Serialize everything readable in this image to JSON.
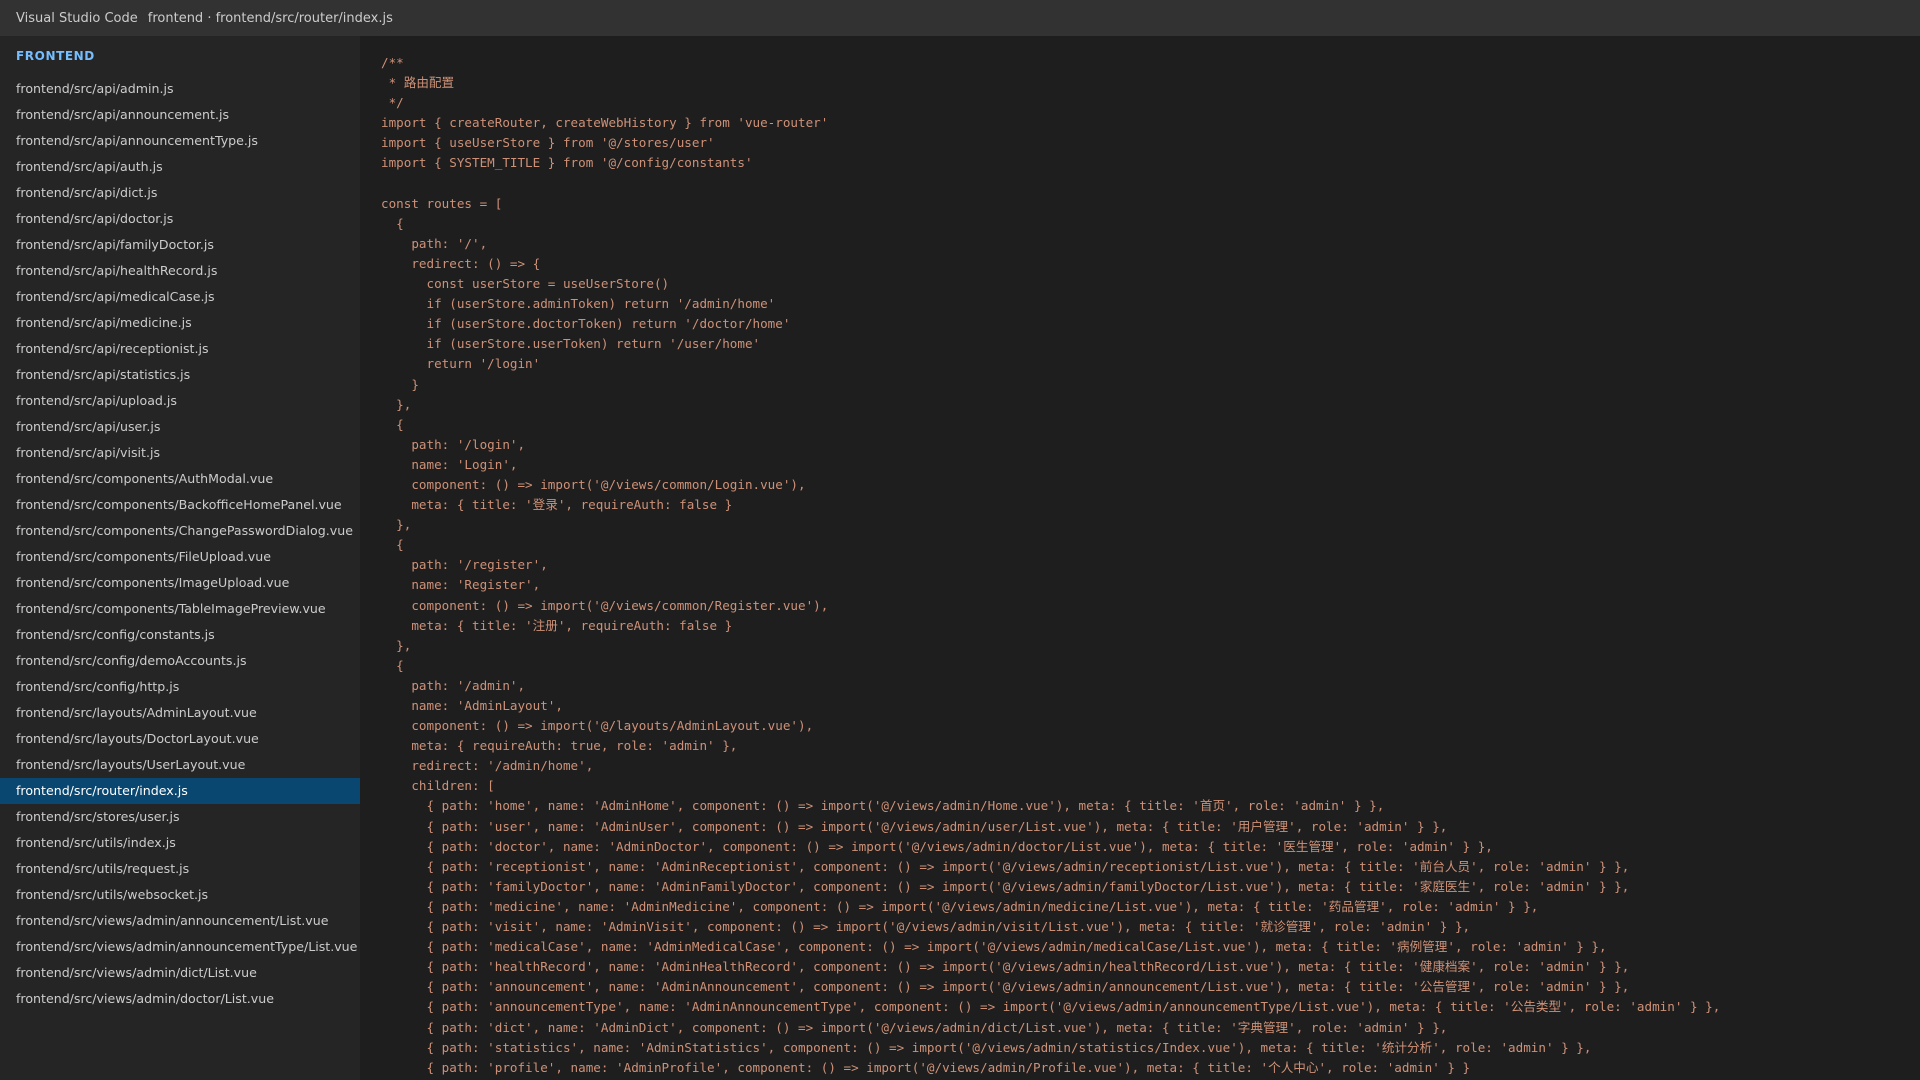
{
  "window": {
    "app_name": "Visual Studio Code",
    "title": "frontend · frontend/src/router/index.js"
  },
  "sidebar": {
    "header": "FRONTEND",
    "active_index": 27,
    "items": [
      "frontend/src/api/admin.js",
      "frontend/src/api/announcement.js",
      "frontend/src/api/announcementType.js",
      "frontend/src/api/auth.js",
      "frontend/src/api/dict.js",
      "frontend/src/api/doctor.js",
      "frontend/src/api/familyDoctor.js",
      "frontend/src/api/healthRecord.js",
      "frontend/src/api/medicalCase.js",
      "frontend/src/api/medicine.js",
      "frontend/src/api/receptionist.js",
      "frontend/src/api/statistics.js",
      "frontend/src/api/upload.js",
      "frontend/src/api/user.js",
      "frontend/src/api/visit.js",
      "frontend/src/components/AuthModal.vue",
      "frontend/src/components/BackofficeHomePanel.vue",
      "frontend/src/components/ChangePasswordDialog.vue",
      "frontend/src/components/FileUpload.vue",
      "frontend/src/components/ImageUpload.vue",
      "frontend/src/components/TableImagePreview.vue",
      "frontend/src/config/constants.js",
      "frontend/src/config/demoAccounts.js",
      "frontend/src/config/http.js",
      "frontend/src/layouts/AdminLayout.vue",
      "frontend/src/layouts/DoctorLayout.vue",
      "frontend/src/layouts/UserLayout.vue",
      "frontend/src/router/index.js",
      "frontend/src/stores/user.js",
      "frontend/src/utils/index.js",
      "frontend/src/utils/request.js",
      "frontend/src/utils/websocket.js",
      "frontend/src/views/admin/announcement/List.vue",
      "frontend/src/views/admin/announcementType/List.vue",
      "frontend/src/views/admin/dict/List.vue",
      "frontend/src/views/admin/doctor/List.vue"
    ]
  },
  "editor": {
    "lines": [
      "/**",
      " * 路由配置",
      " */",
      "import { createRouter, createWebHistory } from 'vue-router'",
      "import { useUserStore } from '@/stores/user'",
      "import { SYSTEM_TITLE } from '@/config/constants'",
      "",
      "const routes = [",
      "  {",
      "    path: '/',",
      "    redirect: () => {",
      "      const userStore = useUserStore()",
      "      if (userStore.adminToken) return '/admin/home'",
      "      if (userStore.doctorToken) return '/doctor/home'",
      "      if (userStore.userToken) return '/user/home'",
      "      return '/login'",
      "    }",
      "  },",
      "  {",
      "    path: '/login',",
      "    name: 'Login',",
      "    component: () => import('@/views/common/Login.vue'),",
      "    meta: { title: '登录', requireAuth: false }",
      "  },",
      "  {",
      "    path: '/register',",
      "    name: 'Register',",
      "    component: () => import('@/views/common/Register.vue'),",
      "    meta: { title: '注册', requireAuth: false }",
      "  },",
      "  {",
      "    path: '/admin',",
      "    name: 'AdminLayout',",
      "    component: () => import('@/layouts/AdminLayout.vue'),",
      "    meta: { requireAuth: true, role: 'admin' },",
      "    redirect: '/admin/home',",
      "    children: [",
      "      { path: 'home', name: 'AdminHome', component: () => import('@/views/admin/Home.vue'), meta: { title: '首页', role: 'admin' } },",
      "      { path: 'user', name: 'AdminUser', component: () => import('@/views/admin/user/List.vue'), meta: { title: '用户管理', role: 'admin' } },",
      "      { path: 'doctor', name: 'AdminDoctor', component: () => import('@/views/admin/doctor/List.vue'), meta: { title: '医生管理', role: 'admin' } },",
      "      { path: 'receptionist', name: 'AdminReceptionist', component: () => import('@/views/admin/receptionist/List.vue'), meta: { title: '前台人员', role: 'admin' } },",
      "      { path: 'familyDoctor', name: 'AdminFamilyDoctor', component: () => import('@/views/admin/familyDoctor/List.vue'), meta: { title: '家庭医生', role: 'admin' } },",
      "      { path: 'medicine', name: 'AdminMedicine', component: () => import('@/views/admin/medicine/List.vue'), meta: { title: '药品管理', role: 'admin' } },",
      "      { path: 'visit', name: 'AdminVisit', component: () => import('@/views/admin/visit/List.vue'), meta: { title: '就诊管理', role: 'admin' } },",
      "      { path: 'medicalCase', name: 'AdminMedicalCase', component: () => import('@/views/admin/medicalCase/List.vue'), meta: { title: '病例管理', role: 'admin' } },",
      "      { path: 'healthRecord', name: 'AdminHealthRecord', component: () => import('@/views/admin/healthRecord/List.vue'), meta: { title: '健康档案', role: 'admin' } },",
      "      { path: 'announcement', name: 'AdminAnnouncement', component: () => import('@/views/admin/announcement/List.vue'), meta: { title: '公告管理', role: 'admin' } },",
      "      { path: 'announcementType', name: 'AdminAnnouncementType', component: () => import('@/views/admin/announcementType/List.vue'), meta: { title: '公告类型', role: 'admin' } },",
      "      { path: 'dict', name: 'AdminDict', component: () => import('@/views/admin/dict/List.vue'), meta: { title: '字典管理', role: 'admin' } },",
      "      { path: 'statistics', name: 'AdminStatistics', component: () => import('@/views/admin/statistics/Index.vue'), meta: { title: '统计分析', role: 'admin' } },",
      "      { path: 'profile', name: 'AdminProfile', component: () => import('@/views/admin/Profile.vue'), meta: { title: '个人中心', role: 'admin' } }"
    ]
  }
}
